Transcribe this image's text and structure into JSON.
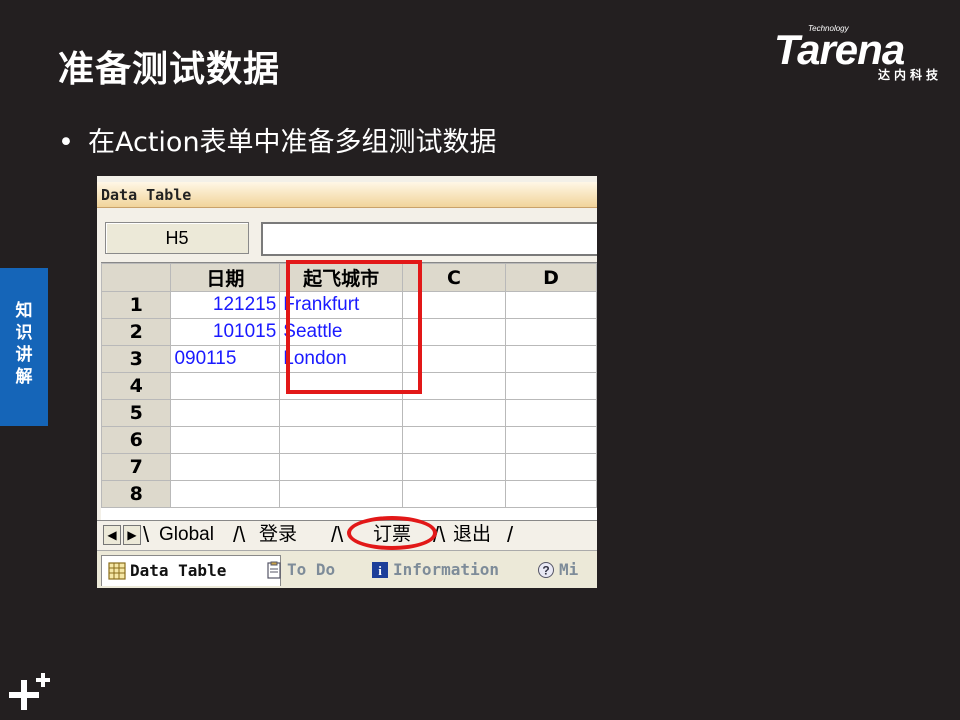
{
  "slide": {
    "title": "准备测试数据",
    "bullet": "在Action表单中准备多组测试数据",
    "bullet_marker": "•",
    "side_tab": [
      "知",
      "识",
      "讲",
      "解"
    ]
  },
  "logo": {
    "small": "Technology",
    "word": "Tarena",
    "cn": "达内科技"
  },
  "screenshot": {
    "window_title": "Data Table",
    "cell_ref": "H5",
    "formula_value": "",
    "columns": [
      "日期",
      "起飞城市",
      "C",
      "D"
    ],
    "row_numbers": [
      "1",
      "2",
      "3",
      "4",
      "5",
      "6",
      "7",
      "8"
    ],
    "rows": [
      [
        "121215",
        "Frankfurt",
        "",
        ""
      ],
      [
        "101015",
        "Seattle",
        "",
        ""
      ],
      [
        "090115",
        "London",
        "",
        ""
      ],
      [
        "",
        "",
        "",
        ""
      ],
      [
        "",
        "",
        "",
        ""
      ],
      [
        "",
        "",
        "",
        ""
      ],
      [
        "",
        "",
        "",
        ""
      ],
      [
        "",
        "",
        "",
        ""
      ]
    ],
    "sheet_tabs": [
      "Global",
      "登录",
      "订票",
      "退出"
    ],
    "nav": {
      "prev": "◀",
      "next": "▶"
    },
    "bottom_tabs": [
      "Data Table",
      "To Do",
      "Information",
      "Mi"
    ],
    "highlight_color": "#e21818",
    "value_color": "#1a1aff"
  }
}
